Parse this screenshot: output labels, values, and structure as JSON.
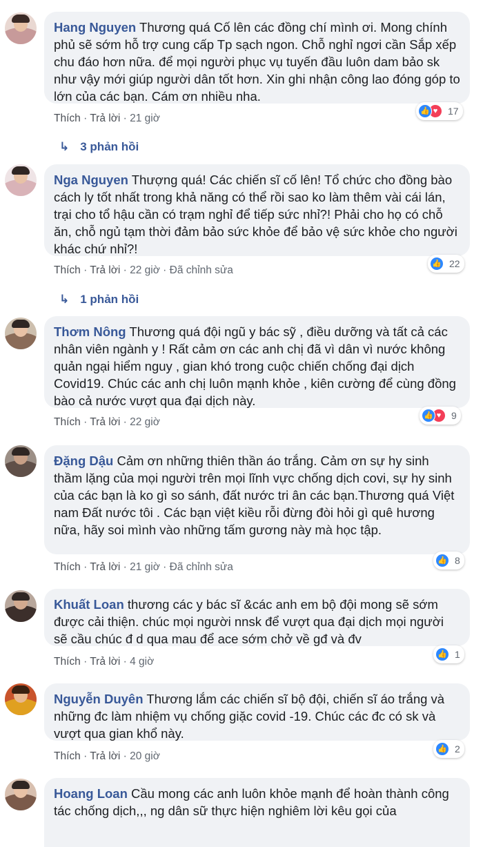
{
  "comments": [
    {
      "author": "Hang Nguyen",
      "text": " Thương quá Cố lên các đồng chí mình ơi. Mong chính phủ sẽ sớm hỗ trợ cung cấp Tp sạch ngon. Chỗ nghỉ ngơi cần Sắp xếp chu đáo hơn nữa. để mọi người phục vụ tuyến đầu luôn dam bảo sk như vậy mới giúp người dân tốt hơn. Xin ghi nhận công lao đóng góp to lớn của các bạn. Cám ơn nhiều nha.",
      "like": "Thích",
      "reply": "Trả lời",
      "time": "21 giờ",
      "reactions": "17",
      "reaction_types": [
        "like",
        "love"
      ],
      "replies_label": "3 phản hồi"
    },
    {
      "author": "Nga Nguyen",
      "text": " Thượng quá! Các chiến sĩ cố lên! Tổ chức cho đồng bào cách ly tốt nhất trong khả năng có thể rồi sao ko làm thêm vài cái lán, trại cho tổ hậu cần có trạm nghỉ để tiếp sức nhỉ?! Phải cho họ có chỗ ăn, chỗ ngủ tạm thời đảm bảo sức khỏe để bảo vệ sức khỏe cho người khác chứ nhỉ?!",
      "like": "Thích",
      "reply": "Trả lời",
      "time": "22 giờ",
      "edited": "Đã chỉnh sửa",
      "reactions": "22",
      "reaction_types": [
        "like"
      ],
      "replies_label": "1 phản hồi"
    },
    {
      "author": "Thơm Nông",
      "text": " Thương quá đội ngũ y bác sỹ , điều dưỡng và tất cả các nhân viên ngành y ! Rất cảm ơn các anh chị đã vì dân vì nước không quản ngại hiểm nguy , gian khó trong cuộc chiến chống đại dịch Covid19. Chúc các anh chị luôn mạnh khỏe , kiên cường để cùng đồng bào cả nước vượt qua đại dịch này.",
      "like": "Thích",
      "reply": "Trả lời",
      "time": "22 giờ",
      "reactions": "9",
      "reaction_types": [
        "like",
        "love"
      ]
    },
    {
      "author": "Đặng Dậu",
      "text": " Cảm ơn những thiên thần áo trắng. Cảm ơn sự hy sinh thầm lặng của mọi người trên mọi lĩnh vực chống dịch covi, sự hy sinh của các bạn là ko gì so sánh, đất nước tri ân các bạn.Thương quá Việt nam Đất nước tôi . Các bạn việt kiều rỗi đừng đòi hỏi gì quê hương nữa, hãy soi mình vào những tấm gương này mà học tập.",
      "like": "Thích",
      "reply": "Trả lời",
      "time": "21 giờ",
      "edited": "Đã chỉnh sửa",
      "reactions": "8",
      "reaction_types": [
        "like"
      ]
    },
    {
      "author": "Khuất Loan",
      "text": " thương các y bác sĩ &các anh em bộ đội mong sẽ sớm được cải thiện. chúc mọi người nnsk để vượt qua đại dịch mọi người sẽ cầu chúc đ d qua mau để ace sớm chở về gđ và đv",
      "like": "Thích",
      "reply": "Trả lời",
      "time": "4 giờ",
      "reactions": "1",
      "reaction_types": [
        "like"
      ]
    },
    {
      "author": "Nguyễn Duyên",
      "text": " Thương lắm các chiến sĩ bộ đội, chiến sĩ áo trắng và những đc làm nhiệm vụ chống giặc covid -19. Chúc các đc có sk và vượt qua gian khổ này.",
      "like": "Thích",
      "reply": "Trả lời",
      "time": "20 giờ",
      "reactions": "2",
      "reaction_types": [
        "like"
      ]
    },
    {
      "author": "Hoang Loan",
      "text": " Cầu mong các anh luôn khỏe mạnh để hoàn thành công tác chống dịch,,, ng dân sữ thực hiện nghiêm lời kêu gọi của"
    }
  ],
  "colors": {
    "author": "#385898",
    "bubble": "#f0f2f5",
    "like": "#2d88ff",
    "love": "#f33e58"
  },
  "icons": {
    "like": "thumbs-up-icon",
    "love": "heart-icon",
    "reply_arrow": "reply-arrow-icon"
  }
}
